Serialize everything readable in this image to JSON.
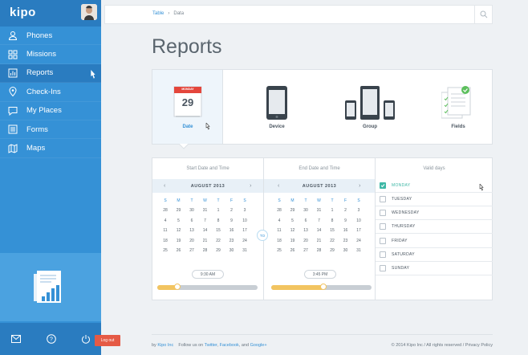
{
  "app": {
    "logo": "kipo"
  },
  "sidebar": {
    "items": [
      {
        "label": "Phones",
        "icon": "user-icon"
      },
      {
        "label": "Missions",
        "icon": "grid-icon"
      },
      {
        "label": "Reports",
        "icon": "chart-icon"
      },
      {
        "label": "Check-Ins",
        "icon": "map-pin-icon"
      },
      {
        "label": "My Places",
        "icon": "chat-icon"
      },
      {
        "label": "Forms",
        "icon": "form-icon"
      },
      {
        "label": "Maps",
        "icon": "map-icon"
      }
    ],
    "active": "Reports",
    "logout": "Log out"
  },
  "topbar": {
    "breadcrumb": [
      "Table",
      "Data"
    ],
    "search_icon": "search-icon"
  },
  "page": {
    "title": "Reports"
  },
  "tiles": {
    "calendar_month": "MONDAY",
    "calendar_day": "29",
    "items": [
      {
        "label": "Date"
      },
      {
        "label": "Device"
      },
      {
        "label": "Group"
      },
      {
        "label": "Fields"
      }
    ]
  },
  "calendar": {
    "start": {
      "heading": "Start Date and Time",
      "month": "AUGUST 2013",
      "time": "9:30 AM",
      "slider_value": 0.2
    },
    "end": {
      "heading": "End Date and Time",
      "month": "AUGUST 2013",
      "time": "3:45 PM",
      "slider_value": 0.52
    },
    "to_label": "TO",
    "dow": [
      "S",
      "M",
      "T",
      "W",
      "T",
      "F",
      "S"
    ],
    "weeks": [
      [
        "28",
        "29",
        "30",
        "31",
        "1",
        "2",
        "3"
      ],
      [
        "4",
        "5",
        "6",
        "7",
        "8",
        "9",
        "10"
      ],
      [
        "11",
        "12",
        "13",
        "14",
        "15",
        "16",
        "17"
      ],
      [
        "18",
        "19",
        "20",
        "21",
        "22",
        "23",
        "24"
      ],
      [
        "25",
        "26",
        "27",
        "28",
        "29",
        "30",
        "31"
      ]
    ]
  },
  "valid_days": {
    "heading": "Valid days",
    "days": [
      {
        "label": "MONDAY",
        "checked": true
      },
      {
        "label": "TUESDAY",
        "checked": false
      },
      {
        "label": "WEDNESDAY",
        "checked": false
      },
      {
        "label": "THURSDAY",
        "checked": false
      },
      {
        "label": "FRIDAY",
        "checked": false
      },
      {
        "label": "SATURDAY",
        "checked": false
      },
      {
        "label": "SUNDAY",
        "checked": false
      }
    ]
  },
  "footer": {
    "by": "by",
    "company": "Kipo Inc",
    "follow": "Follow us on",
    "twitter": "Twitter",
    "facebook": "Facebook",
    "and": "and",
    "google": "Google+",
    "copyright": "© 2014 Kipo Inc / All rights reserved / Privacy Policy"
  },
  "colors": {
    "sidebar": "#3591d6",
    "accent": "#3591d6",
    "check": "#3fb8a6",
    "slider": "#f2c460",
    "logout": "#e55a45"
  }
}
